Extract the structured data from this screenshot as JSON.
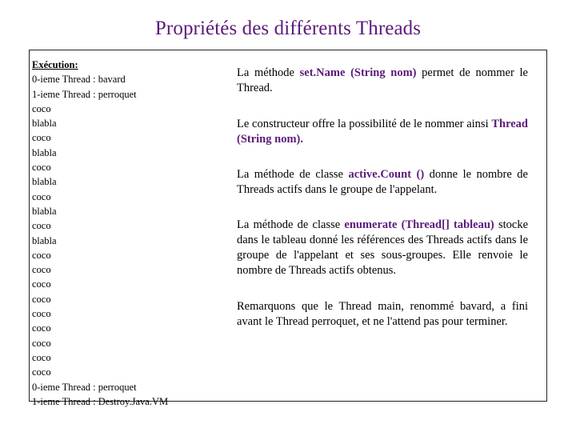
{
  "slide": {
    "title": "Propriétés des différents Threads",
    "left_panel": {
      "heading": "Exécution:",
      "lines": [
        "0-ieme Thread : bavard",
        "1-ieme Thread : perroquet",
        "coco",
        "blabla",
        "coco",
        "blabla",
        "coco",
        "blabla",
        "coco",
        "blabla",
        "coco",
        "blabla",
        "coco",
        "coco",
        "coco",
        "coco",
        "coco",
        "coco",
        "coco",
        "coco",
        "coco",
        "0-ieme Thread : perroquet",
        "1-ieme Thread : Destroy.Java.VM"
      ]
    },
    "right_panel": {
      "paragraphs": [
        {
          "id": "p1",
          "parts": [
            {
              "text": "La méthode ",
              "style": "normal"
            },
            {
              "text": "set.Name (String nom)",
              "style": "keyword"
            },
            {
              "text": " permet de nommer le Thread.",
              "style": "normal"
            }
          ]
        },
        {
          "id": "p2",
          "parts": [
            {
              "text": "Le constructeur offre la possibilité de le nommer ainsi ",
              "style": "normal"
            },
            {
              "text": "Thread (String nom).",
              "style": "keyword"
            }
          ]
        },
        {
          "id": "p3",
          "parts": [
            {
              "text": "La méthode de classe ",
              "style": "normal"
            },
            {
              "text": "active.Count ()",
              "style": "keyword"
            },
            {
              "text": " donne le nombre de Threads actifs dans le groupe de l'appelant.",
              "style": "normal"
            }
          ]
        },
        {
          "id": "p4",
          "parts": [
            {
              "text": "La méthode de classe ",
              "style": "normal"
            },
            {
              "text": "enumerate (Thread[] tableau)",
              "style": "keyword"
            },
            {
              "text": " stocke dans le tableau donné les références des Threads actifs dans le groupe de l'appelant et ses sous-groupes. Elle renvoie le nombre de Threads actifs obtenus.",
              "style": "normal"
            }
          ]
        },
        {
          "id": "p5",
          "parts": [
            {
              "text": "Remarquons que le Thread main, renommé bavard, a fini avant le Thread perroquet, et ne l'attend pas pour terminer.",
              "style": "normal"
            }
          ]
        }
      ]
    },
    "colors": {
      "title": "#5c1b7a",
      "keyword": "#5c1b7a",
      "text": "#000000",
      "border": "#222222"
    }
  }
}
